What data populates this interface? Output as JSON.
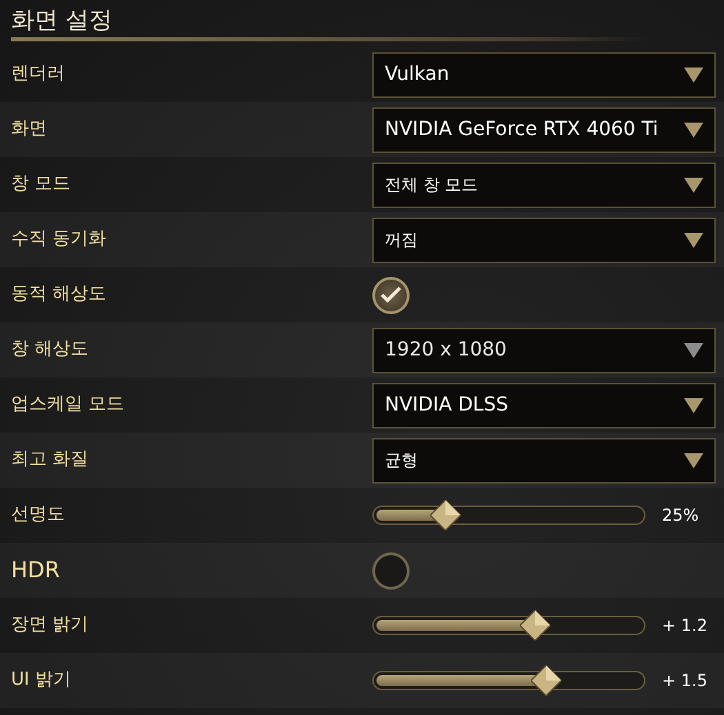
{
  "title": "화면 설정",
  "settings": [
    {
      "label": "렌더러",
      "kind": "dropdown",
      "value": "Vulkan",
      "disabled": false
    },
    {
      "label": "화면",
      "kind": "dropdown",
      "value": "NVIDIA GeForce RTX 4060 Ti",
      "disabled": false
    },
    {
      "label": "창 모드",
      "kind": "dropdown",
      "value": "전체 창 모드",
      "disabled": false
    },
    {
      "label": "수직 동기화",
      "kind": "dropdown",
      "value": "꺼짐",
      "disabled": false
    },
    {
      "label": "동적 해상도",
      "kind": "checkbox",
      "checked": true
    },
    {
      "label": "창 해상도",
      "kind": "dropdown",
      "value": "1920 x 1080",
      "disabled": true
    },
    {
      "label": "업스케일 모드",
      "kind": "dropdown",
      "value": "NVIDIA DLSS",
      "disabled": false
    },
    {
      "label": "최고 화질",
      "kind": "dropdown",
      "value": "균형",
      "disabled": false
    },
    {
      "label": "선명도",
      "kind": "slider",
      "level": 0.26,
      "reading": "25%"
    },
    {
      "label": "HDR",
      "kind": "checkbox",
      "checked": false
    },
    {
      "label": "장면 밝기",
      "kind": "slider",
      "level": 0.6,
      "reading": "+ 1.2"
    },
    {
      "label": "UI 밝기",
      "kind": "slider",
      "level": 0.64,
      "reading": "+ 1.5"
    }
  ]
}
